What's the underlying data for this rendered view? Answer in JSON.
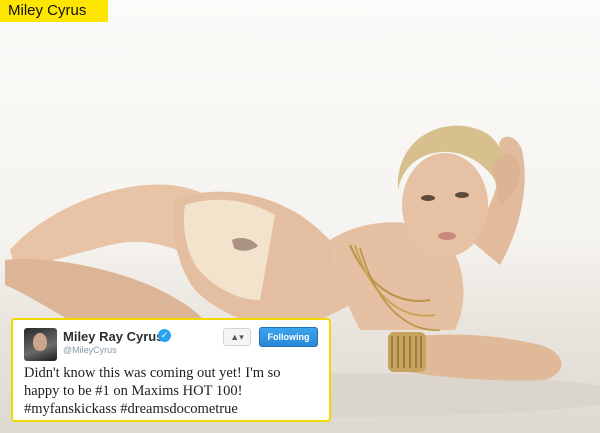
{
  "caption": "Miley Cyrus",
  "tweet": {
    "display_name": "Miley Ray Cyrus",
    "handle": "@MileyCyrus",
    "follow_button": "Following",
    "lines": [
      "Didn't know this was coming out yet! I'm so",
      "happy to be #1 on Maxims HOT 100!",
      "#myfanskickass #dreamsdocometrue"
    ]
  },
  "icons": [
    "verified-icon",
    "person-menu-icon",
    "avatar"
  ],
  "colors": {
    "caption_bg": "#ffe600",
    "card_border": "#f1d800",
    "button_blue": "#2a88d6"
  }
}
